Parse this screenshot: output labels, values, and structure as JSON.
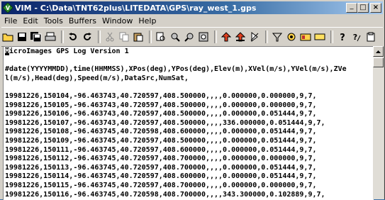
{
  "window": {
    "title": "VIM - C:\\Data\\TNT62plus\\LITEDATA\\GPS\\ray_west_1.gps",
    "minimize": "_",
    "maximize": "□",
    "close": "×"
  },
  "menu": [
    "File",
    "Edit",
    "Tools",
    "Buffers",
    "Window",
    "Help"
  ],
  "toolbar": {
    "icons": [
      "open-icon",
      "save-icon",
      "save-all-icon",
      "print-icon",
      "undo-icon",
      "redo-icon",
      "cut-icon",
      "copy-icon",
      "paste-icon",
      "find-icon",
      "find-next-icon",
      "find-prev-icon",
      "replace-icon",
      "load-session-icon",
      "save-session-icon",
      "run-script-icon",
      "make-icon",
      "shell-icon",
      "tags-icon",
      "help-icon",
      "find-help-icon"
    ]
  },
  "editor": {
    "cursor_char": "M",
    "first_line_rest": "icroImages GPS Log Version 1",
    "lines": [
      "",
      "#date(YYYYMMDD),time(HHMMSS),XPos(deg),YPos(deg),Elev(m),XVel(m/s),YVel(m/s),ZVe",
      "l(m/s),Head(deg),Speed(m/s),DataSrc,NumSat,",
      "",
      "19981226,150104,-96.463743,40.720597,408.500000,,,,0.000000,0.000000,9,7,",
      "19981226,150105,-96.463743,40.720597,408.500000,,,,0.000000,0.000000,9,7,",
      "19981226,150106,-96.463743,40.720597,408.500000,,,,0.000000,0.051444,9,7,",
      "19981226,150107,-96.463743,40.720597,408.500000,,,,336.000000,0.051444,9,7,",
      "19981226,150108,-96.463745,40.720598,408.600000,,,,0.000000,0.051444,9,7,",
      "19981226,150109,-96.463745,40.720597,408.500000,,,,0.000000,0.051444,9,7,",
      "19981226,150111,-96.463745,40.720597,408.600000,,,,0.000000,0.051444,9,7,",
      "19981226,150112,-96.463745,40.720597,408.700000,,,,0.000000,0.000000,9,7,",
      "19981226,150113,-96.463745,40.720597,408.700000,,,,0.000000,0.051444,9,7,",
      "19981226,150114,-96.463745,40.720597,408.600000,,,,0.000000,0.051444,9,7,",
      "19981226,150115,-96.463745,40.720597,408.700000,,,,0.000000,0.000000,9,7,",
      "19981226,150116,-96.463745,40.720598,408.700000,,,,343.300000,0.102889,9,7,"
    ]
  }
}
